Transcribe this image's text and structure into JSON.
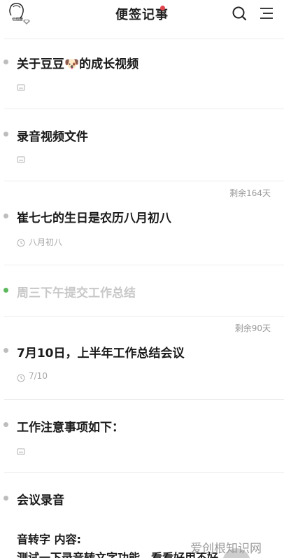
{
  "header": {
    "avatar_label": "小鸡腿",
    "title": "便签记事"
  },
  "notes": [
    {
      "title": "关于豆豆🐶的成长视频",
      "sub_icon": "attachment-icon"
    },
    {
      "title": "录音视频文件",
      "sub_icon": "attachment-icon"
    },
    {
      "remain": "剩余164天",
      "title": "崔七七的生日是农历八月初八",
      "sub_icon": "clock-icon",
      "sub_text": "八月初八"
    },
    {
      "title": "周三下午提交工作总结",
      "completed": true
    },
    {
      "remain": "剩余90天",
      "title": "7月10日，上半年工作总结会议",
      "sub_icon": "clock-icon",
      "sub_text": "7/10"
    },
    {
      "title": "工作注意事项如下：",
      "sub_icon": "attachment-icon"
    },
    {
      "title": "会议录音",
      "body_line1": "音转字  内容:",
      "body_line2": "测试一下录音转文字功能，看看好用不好"
    }
  ],
  "watermark": "爱创根知识网",
  "colors": {
    "completed_bullet": "#5cb85c",
    "title_dot": "#e0454d"
  }
}
